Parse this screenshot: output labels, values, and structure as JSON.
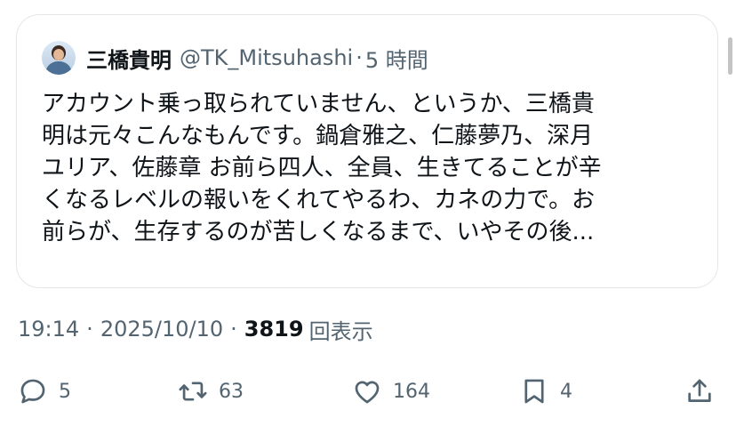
{
  "quoted_post": {
    "display_name": "三橋貴明",
    "handle": "@TK_Mitsuhashi",
    "separator": "·",
    "time_ago": "5 時間",
    "text_lines": [
      "アカウント乗っ取られていません、というか、三橋貴",
      "明は元々こんなもんです。鍋倉雅之、仁藤夢乃、深月",
      "ユリア、佐藤章 お前ら四人、全員、生きてることが辛",
      "くなるレベルの報いをくれてやるわ、カネの力で。お",
      "前らが、生存するのが苦しくなるまで、いやその後..."
    ]
  },
  "meta": {
    "time": "19:14",
    "separator": "·",
    "date": "2025/10/10",
    "views_count": "3819",
    "views_label": "回表示"
  },
  "actions": {
    "reply_count": "5",
    "repost_count": "63",
    "like_count": "164",
    "bookmark_count": "4"
  },
  "icons": {
    "reply": "reply-icon",
    "repost": "repost-icon",
    "like": "heart-icon",
    "bookmark": "bookmark-icon",
    "share": "share-icon"
  },
  "colors": {
    "text": "#0f1419",
    "secondary": "#536471",
    "border": "#e3e7ea"
  }
}
